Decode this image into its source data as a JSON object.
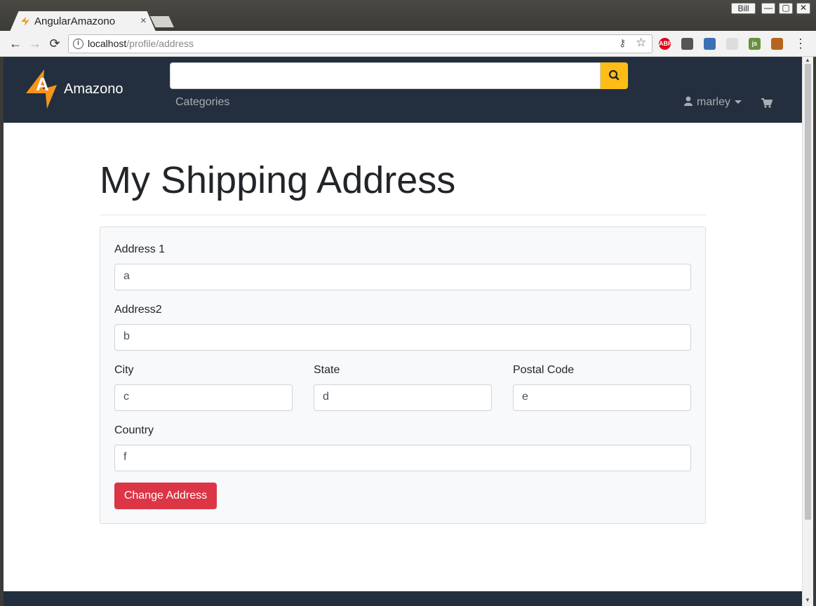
{
  "browser": {
    "tab_title": "AngularAmazono",
    "tab_close": "×",
    "user_label": "Bill",
    "win_min": "—",
    "win_max": "▢",
    "win_close": "✕",
    "url_host": "localhost",
    "url_path": "/profile/address",
    "back_glyph": "←",
    "forward_glyph": "→",
    "reload_glyph": "⟳",
    "extensions": [
      {
        "name": "adblock-icon",
        "label": "ABP",
        "color": "#e0001a"
      },
      {
        "name": "sync-icon",
        "label": "",
        "color": "#555555"
      },
      {
        "name": "colorpicker-icon",
        "label": "",
        "color": "#3b6fb6"
      },
      {
        "name": "react-icon",
        "label": "",
        "color": "#dddddd"
      },
      {
        "name": "js-icon",
        "label": "js",
        "color": "#6a8f3c"
      },
      {
        "name": "monkey-icon",
        "label": "",
        "color": "#b5651d"
      }
    ]
  },
  "navbar": {
    "brand": "Amazono",
    "search_placeholder": "",
    "categories": "Categories",
    "username": "marley"
  },
  "page": {
    "title": "My Shipping Address"
  },
  "form": {
    "address1_label": "Address 1",
    "address1_value": "a",
    "address2_label": "Address2",
    "address2_value": "b",
    "city_label": "City",
    "city_value": "c",
    "state_label": "State",
    "state_value": "d",
    "postal_label": "Postal Code",
    "postal_value": "e",
    "country_label": "Country",
    "country_value": "f",
    "submit_label": "Change Address"
  },
  "colors": {
    "navbar_bg": "#232f3e",
    "search_button": "#febd16",
    "primary_action": "#dc3545",
    "logo_orange": "#f7941d"
  }
}
